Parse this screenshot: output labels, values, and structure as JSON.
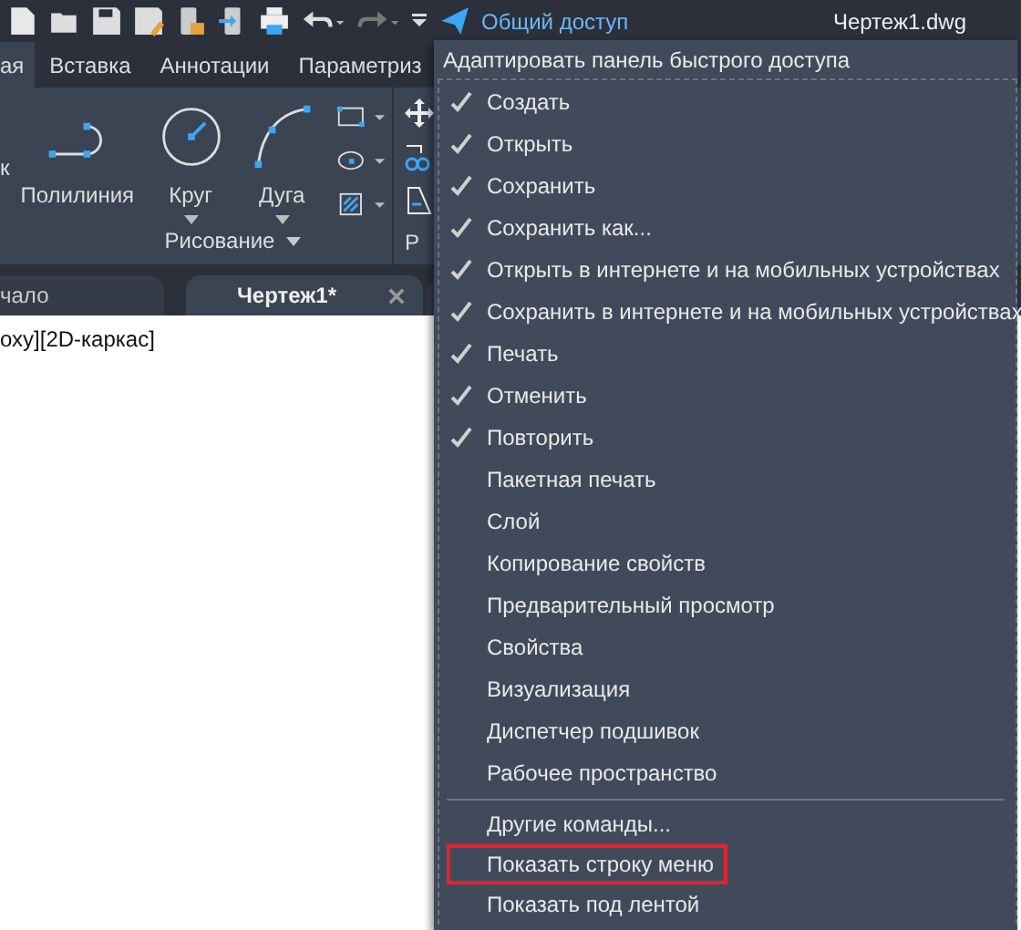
{
  "quick_access": {
    "share_label": "Общий доступ",
    "file_title": "Чертеж1.dwg"
  },
  "ribbon_tabs": [
    {
      "label": "ая",
      "selected": true
    },
    {
      "label": "Вставка",
      "selected": false
    },
    {
      "label": "Аннотации",
      "selected": false
    },
    {
      "label": "Параметриз",
      "selected": false
    }
  ],
  "tools": [
    {
      "label": "к",
      "kind": "cut"
    },
    {
      "label": "Полилиния",
      "kind": "polyline"
    },
    {
      "label": "Круг",
      "kind": "circle"
    },
    {
      "label": "Дуга",
      "kind": "arc"
    }
  ],
  "panel_label": "Рисование",
  "panel_label_2": "Р",
  "doc_tabs": [
    {
      "label": "чало",
      "selected": false
    },
    {
      "label": "Чертеж1*",
      "selected": true
    }
  ],
  "viewport_label": "оху][2D-каркас]",
  "menu": {
    "title": "Адаптировать панель быстрого доступа",
    "items": [
      {
        "label": "Создать",
        "checked": true
      },
      {
        "label": "Открыть",
        "checked": true
      },
      {
        "label": "Сохранить",
        "checked": true
      },
      {
        "label": "Сохранить как...",
        "checked": true
      },
      {
        "label": "Открыть в интернете и на мобильных устройствах",
        "checked": true
      },
      {
        "label": "Сохранить в интернете и на мобильных устройствах",
        "checked": true
      },
      {
        "label": "Печать",
        "checked": true
      },
      {
        "label": "Отменить",
        "checked": true
      },
      {
        "label": "Повторить",
        "checked": true
      },
      {
        "label": "Пакетная печать",
        "checked": false
      },
      {
        "label": "Слой",
        "checked": false
      },
      {
        "label": "Копирование свойств",
        "checked": false
      },
      {
        "label": "Предварительный просмотр",
        "checked": false
      },
      {
        "label": "Свойства",
        "checked": false
      },
      {
        "label": "Визуализация",
        "checked": false
      },
      {
        "label": "Диспетчер подшивок",
        "checked": false
      },
      {
        "label": "Рабочее пространство",
        "checked": false
      }
    ],
    "extra_items": [
      {
        "label": "Другие команды...",
        "highlighted": false
      },
      {
        "label": "Показать строку меню",
        "highlighted": true
      },
      {
        "label": "Показать под лентой",
        "highlighted": false
      }
    ]
  }
}
